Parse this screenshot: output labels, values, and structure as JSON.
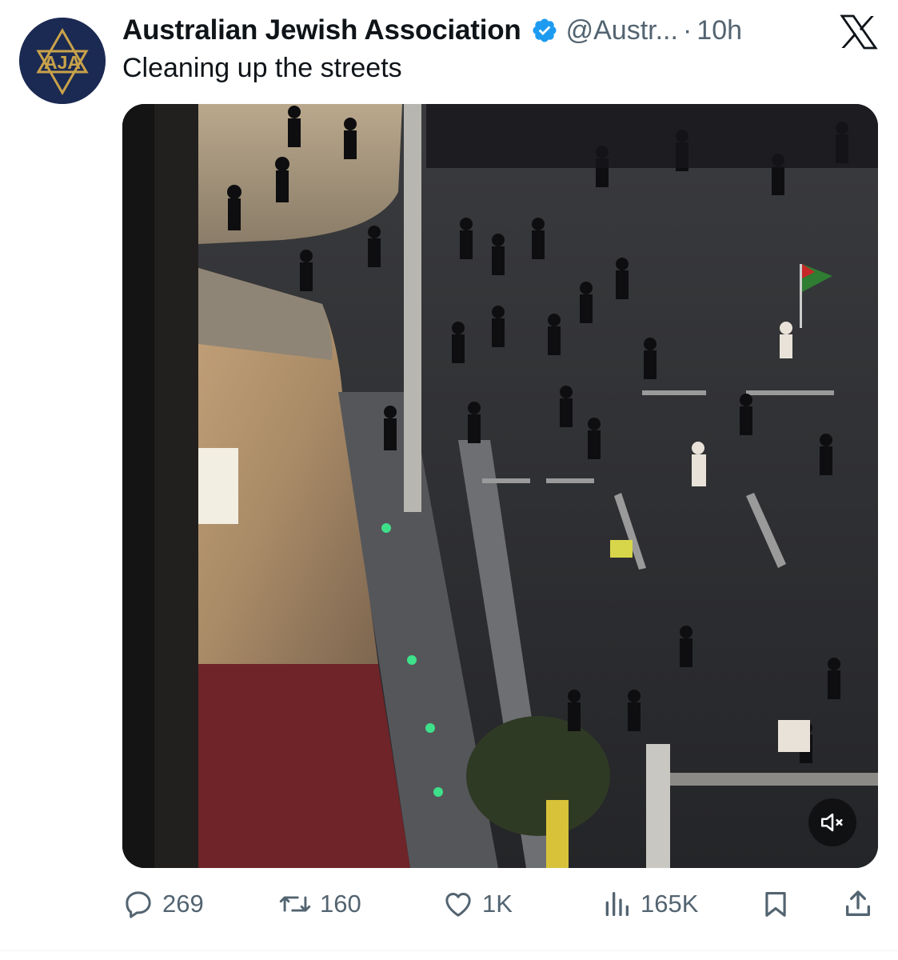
{
  "tweet": {
    "author_name": "Australian Jewish Association",
    "avatar_text": "AJA",
    "handle": "@Austr...",
    "separator": "·",
    "timestamp": "10h",
    "text": "Cleaning up the streets"
  },
  "media": {
    "type": "video",
    "muted": true
  },
  "actions": {
    "replies": "269",
    "reposts": "160",
    "likes": "1K",
    "views": "165K"
  },
  "colors": {
    "text_primary": "#0f1419",
    "text_secondary": "#536471",
    "verified_blue": "#1d9bf0",
    "avatar_navy": "#1b2a52",
    "avatar_gold": "#c9a24a"
  },
  "icons": {
    "platform_logo": "x-logo-icon",
    "verified": "verified-badge-icon",
    "reply": "reply-icon",
    "repost": "repost-icon",
    "like": "heart-icon",
    "views": "views-chart-icon",
    "bookmark": "bookmark-icon",
    "share": "share-icon",
    "mute": "speaker-muted-icon"
  }
}
